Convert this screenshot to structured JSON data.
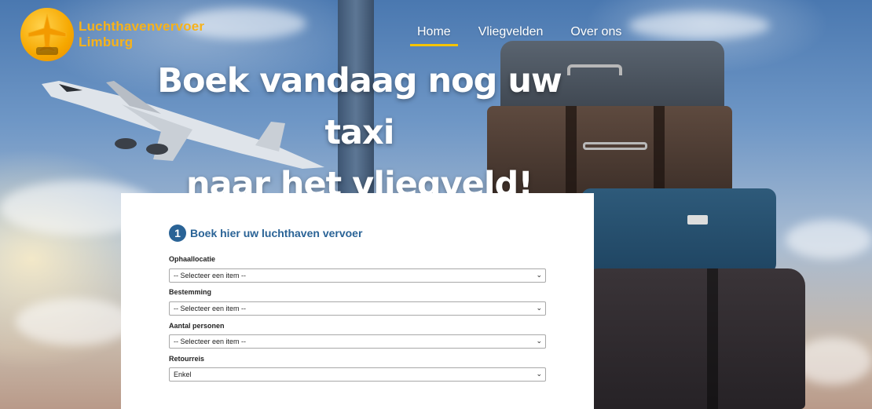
{
  "header": {
    "logo_line1": "Luchthavenvervoer",
    "logo_line2": "Limburg",
    "nav": [
      {
        "label": "Home",
        "active": true
      },
      {
        "label": "Vliegvelden",
        "active": false
      },
      {
        "label": "Over ons",
        "active": false
      }
    ]
  },
  "hero": {
    "headline_line1": "Boek vandaag nog uw taxi",
    "headline_line2": "naar het vliegveld!"
  },
  "form": {
    "step_number": "1",
    "step_title": "Boek hier uw luchthaven vervoer",
    "fields": [
      {
        "label": "Ophaallocatie",
        "value": "-- Selecteer een item --"
      },
      {
        "label": "Bestemming",
        "value": "-- Selecteer een item --"
      },
      {
        "label": "Aantal personen",
        "value": "-- Selecteer een item --"
      },
      {
        "label": "Retourreis",
        "value": "Enkel"
      }
    ]
  },
  "colors": {
    "accent_orange": "#f7b21a",
    "nav_underline": "#f5c400",
    "step_blue": "#2a6396"
  }
}
